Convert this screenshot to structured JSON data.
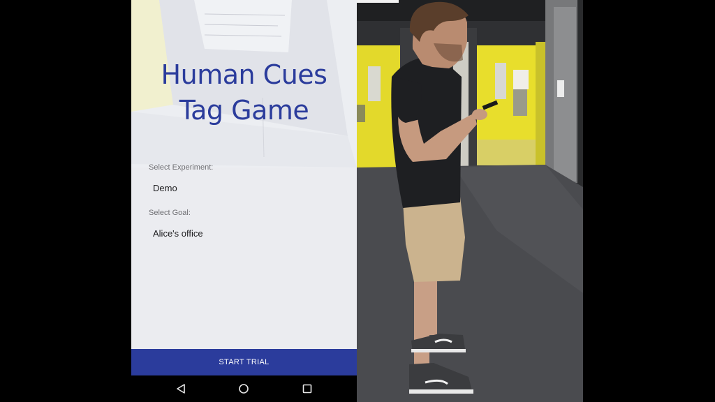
{
  "app": {
    "title_line1": "Human Cues",
    "title_line2": "Tag Game"
  },
  "form": {
    "experiment_label": "Select Experiment:",
    "experiment_value": "Demo",
    "goal_label": "Select Goal:",
    "goal_value": "Alice's office"
  },
  "actions": {
    "start_label": "START TRIAL"
  },
  "navigation": {
    "icons": [
      "back-triangle-icon",
      "home-circle-icon",
      "recent-apps-square-icon"
    ]
  },
  "colors": {
    "accent": "#2b3c9c",
    "screen_background": "#ecedf1",
    "door_yellow": "#e8de2c"
  }
}
